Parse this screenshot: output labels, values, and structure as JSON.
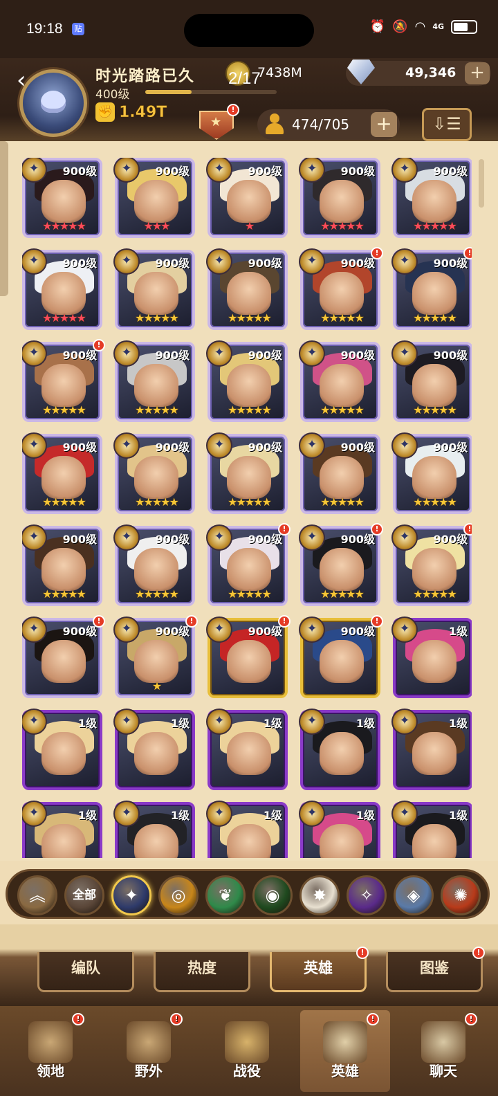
{
  "statusbar": {
    "time": "19:18",
    "app_badge": "贴",
    "network": "4G"
  },
  "player": {
    "name": "时光踏路已久",
    "level": "400级",
    "xp": 0.35,
    "power": "1.49T"
  },
  "resources": {
    "gold": "7438M",
    "gems": "49,346",
    "add": "+"
  },
  "page_indicator": "2/17",
  "hero_count": {
    "value": "474/705",
    "add": "+"
  },
  "sort_icon": "sort-icon",
  "heroes": [
    {
      "level": "900级",
      "stars": "★★★★★",
      "star_color": "red",
      "frame": "normal",
      "hair": "#2a1a1c"
    },
    {
      "level": "900级",
      "stars": "★★★",
      "star_color": "red",
      "frame": "normal",
      "hair": "#e8c86a"
    },
    {
      "level": "900级",
      "stars": "★",
      "star_color": "red",
      "frame": "normal",
      "hair": "#f2e6d4"
    },
    {
      "level": "900级",
      "stars": "★★★★★",
      "star_color": "red",
      "frame": "normal",
      "hair": "#2f2a2c"
    },
    {
      "level": "900级",
      "stars": "★★★★★",
      "star_color": "red",
      "frame": "normal",
      "hair": "#d8dde2"
    },
    {
      "level": "900级",
      "stars": "★★★★★",
      "star_color": "red",
      "frame": "normal",
      "hair": "#eef0f4"
    },
    {
      "level": "900级",
      "stars": "★★★★★",
      "star_color": "gold",
      "frame": "normal",
      "hair": "#e3cfa0"
    },
    {
      "level": "900级",
      "stars": "★★★★★",
      "star_color": "gold",
      "frame": "normal",
      "hair": "#5a4630"
    },
    {
      "level": "900级",
      "stars": "★★★★★",
      "star_color": "gold",
      "frame": "normal",
      "hair": "#b2452b",
      "notif": true
    },
    {
      "level": "900级",
      "stars": "★★★★★",
      "star_color": "gold",
      "frame": "normal",
      "hair": "#263352",
      "notif": true
    },
    {
      "level": "900级",
      "stars": "★★★★★",
      "star_color": "gold",
      "frame": "normal",
      "hair": "#a8714a",
      "notif": true
    },
    {
      "level": "900级",
      "stars": "★★★★★",
      "star_color": "gold",
      "frame": "normal",
      "hair": "#c7c7c7"
    },
    {
      "level": "900级",
      "stars": "★★★★★",
      "star_color": "gold",
      "frame": "normal",
      "hair": "#e3c778"
    },
    {
      "level": "900级",
      "stars": "★★★★★",
      "star_color": "gold",
      "frame": "normal",
      "hair": "#d05288"
    },
    {
      "level": "900级",
      "stars": "★★★★★",
      "star_color": "gold",
      "frame": "normal",
      "hair": "#1d1b22"
    },
    {
      "level": "900级",
      "stars": "★★★★★",
      "star_color": "gold",
      "frame": "normal",
      "hair": "#c52a2a"
    },
    {
      "level": "900级",
      "stars": "★★★★★",
      "star_color": "gold",
      "frame": "normal",
      "hair": "#e2c48a"
    },
    {
      "level": "900级",
      "stars": "★★★★★",
      "star_color": "gold",
      "frame": "normal",
      "hair": "#e8d7a2"
    },
    {
      "level": "900级",
      "stars": "★★★★★",
      "star_color": "gold",
      "frame": "normal",
      "hair": "#5a3a22"
    },
    {
      "level": "900级",
      "stars": "★★★★★",
      "star_color": "gold",
      "frame": "normal",
      "hair": "#e8eef0"
    },
    {
      "level": "900级",
      "stars": "★★★★★",
      "star_color": "gold",
      "frame": "normal",
      "hair": "#4a3020"
    },
    {
      "level": "900级",
      "stars": "★★★★★",
      "star_color": "gold",
      "frame": "normal",
      "hair": "#efefef"
    },
    {
      "level": "900级",
      "stars": "★★★★★",
      "star_color": "gold",
      "frame": "normal",
      "hair": "#e8e0e8",
      "notif": true
    },
    {
      "level": "900级",
      "stars": "★★★★★",
      "star_color": "gold",
      "frame": "normal",
      "hair": "#1a1a1e",
      "notif": true
    },
    {
      "level": "900级",
      "stars": "★★★★★",
      "star_color": "gold",
      "frame": "normal",
      "hair": "#efe1a2",
      "notif": true
    },
    {
      "level": "900级",
      "stars": "",
      "star_color": "gold",
      "frame": "normal",
      "hair": "#1b1512",
      "notif": true
    },
    {
      "level": "900级",
      "stars": "★",
      "star_color": "gold",
      "frame": "normal",
      "hair": "#c8a868",
      "notif": true
    },
    {
      "level": "900级",
      "stars": "",
      "star_color": "gold",
      "frame": "gold",
      "hair": "#c52525",
      "notif": true
    },
    {
      "level": "900级",
      "stars": "",
      "star_color": "gold",
      "frame": "gold",
      "hair": "#2a4a8a",
      "notif": true
    },
    {
      "level": "1级",
      "stars": "",
      "star_color": "gold",
      "frame": "epic",
      "hair": "#d64a8a"
    },
    {
      "level": "1级",
      "stars": "",
      "star_color": "gold",
      "frame": "epic",
      "hair": "#ecd29a"
    },
    {
      "level": "1级",
      "stars": "",
      "star_color": "gold",
      "frame": "epic",
      "hair": "#ecd29a"
    },
    {
      "level": "1级",
      "stars": "",
      "star_color": "gold",
      "frame": "epic",
      "hair": "#ecd29a"
    },
    {
      "level": "1级",
      "stars": "",
      "star_color": "gold",
      "frame": "epic",
      "hair": "#1a1a1e"
    },
    {
      "level": "1级",
      "stars": "",
      "star_color": "gold",
      "frame": "epic",
      "hair": "#5a3a22"
    },
    {
      "level": "1级",
      "stars": "",
      "star_color": "gold",
      "frame": "epic",
      "hair": "#d8b878"
    },
    {
      "level": "1级",
      "stars": "",
      "star_color": "gold",
      "frame": "epic",
      "hair": "#222226"
    },
    {
      "level": "1级",
      "stars": "",
      "star_color": "gold",
      "frame": "epic",
      "hair": "#ecd29a"
    },
    {
      "level": "1级",
      "stars": "",
      "star_color": "gold",
      "frame": "epic",
      "hair": "#d64a8a"
    },
    {
      "level": "1级",
      "stars": "",
      "star_color": "gold",
      "frame": "epic",
      "hair": "#1a1a1e"
    }
  ],
  "factions": [
    {
      "name": "collapse-icon",
      "label": "︽",
      "bg": "#8a6a42"
    },
    {
      "name": "all-faction",
      "label": "全部",
      "bg": "#5a4638"
    },
    {
      "name": "lightbearer-icon",
      "label": "✦",
      "bg": "#2e3a6a"
    },
    {
      "name": "mauler-icon",
      "label": "◎",
      "bg": "#c8861a"
    },
    {
      "name": "wilder-icon",
      "label": "❦",
      "bg": "#2f8a4a"
    },
    {
      "name": "graveborn-icon",
      "label": "◉",
      "bg": "#1f4a1f"
    },
    {
      "name": "celestial-icon",
      "label": "✸",
      "bg": "#e8e0d0"
    },
    {
      "name": "hypogean-icon",
      "label": "✧",
      "bg": "#5a2a8a"
    },
    {
      "name": "dimensional-icon",
      "label": "◈",
      "bg": "#5a7aa8"
    },
    {
      "name": "dragon-icon",
      "label": "✺",
      "bg": "#b83a1a"
    }
  ],
  "tabs": [
    {
      "label": "编队",
      "active": false,
      "notif": false
    },
    {
      "label": "热度",
      "active": false,
      "notif": false
    },
    {
      "label": "英雄",
      "active": true,
      "notif": true
    },
    {
      "label": "图鉴",
      "active": false,
      "notif": true
    }
  ],
  "bottomnav": [
    {
      "label": "领地",
      "icon": "castle-icon",
      "active": false,
      "notif": true
    },
    {
      "label": "野外",
      "icon": "map-scroll-icon",
      "active": false,
      "notif": true
    },
    {
      "label": "战役",
      "icon": "campaign-sword-icon",
      "active": false,
      "notif": false
    },
    {
      "label": "英雄",
      "icon": "hero-helmet-icon",
      "active": true,
      "notif": true
    },
    {
      "label": "聊天",
      "icon": "chat-bubble-icon",
      "active": false,
      "notif": true
    }
  ],
  "colors": {
    "accent": "#e8be39",
    "notif": "#e53b26",
    "panel": "#f0dfbb"
  }
}
